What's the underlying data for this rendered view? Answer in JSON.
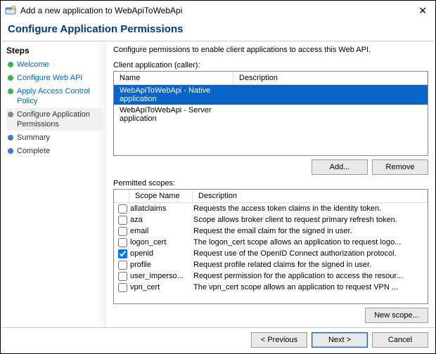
{
  "window": {
    "title": "Add a new application to WebApiToWebApi",
    "close": "✕"
  },
  "page_header": "Configure Application Permissions",
  "steps_heading": "Steps",
  "steps": [
    {
      "label": "Welcome",
      "state": "done",
      "link": true
    },
    {
      "label": "Configure Web API",
      "state": "done",
      "link": true
    },
    {
      "label": "Apply Access Control Policy",
      "state": "done",
      "link": true
    },
    {
      "label": "Configure Application Permissions",
      "state": "current",
      "link": false
    },
    {
      "label": "Summary",
      "state": "pending",
      "link": false
    },
    {
      "label": "Complete",
      "state": "pending",
      "link": false
    }
  ],
  "instruction": "Configure permissions to enable client applications to access this Web API.",
  "client_label": "Client application (caller):",
  "client_columns": {
    "name": "Name",
    "description": "Description"
  },
  "client_apps": [
    {
      "name": "WebApiToWebApi - Native application",
      "description": "",
      "selected": true
    },
    {
      "name": "WebApiToWebApi - Server application",
      "description": "",
      "selected": false
    }
  ],
  "buttons": {
    "add": "Add...",
    "remove": "Remove",
    "new_scope": "New scope...",
    "previous": "< Previous",
    "next": "Next >",
    "cancel": "Cancel"
  },
  "scopes_label": "Permitted scopes:",
  "scopes_columns": {
    "name": "Scope Name",
    "description": "Description"
  },
  "scopes": [
    {
      "checked": false,
      "name": "allatclaims",
      "desc": "Requests the access token claims in the identity token."
    },
    {
      "checked": false,
      "name": "aza",
      "desc": "Scope allows broker client to request primary refresh token."
    },
    {
      "checked": false,
      "name": "email",
      "desc": "Request the email claim for the signed in user."
    },
    {
      "checked": false,
      "name": "logon_cert",
      "desc": "The logon_cert scope allows an application to request logo..."
    },
    {
      "checked": true,
      "name": "openid",
      "desc": "Request use of the OpenID Connect authorization protocol."
    },
    {
      "checked": false,
      "name": "profile",
      "desc": "Request profile related claims for the signed in user."
    },
    {
      "checked": false,
      "name": "user_imperso...",
      "desc": "Request permission for the application to access the resour..."
    },
    {
      "checked": false,
      "name": "vpn_cert",
      "desc": "The vpn_cert scope allows an application to request VPN ..."
    }
  ]
}
